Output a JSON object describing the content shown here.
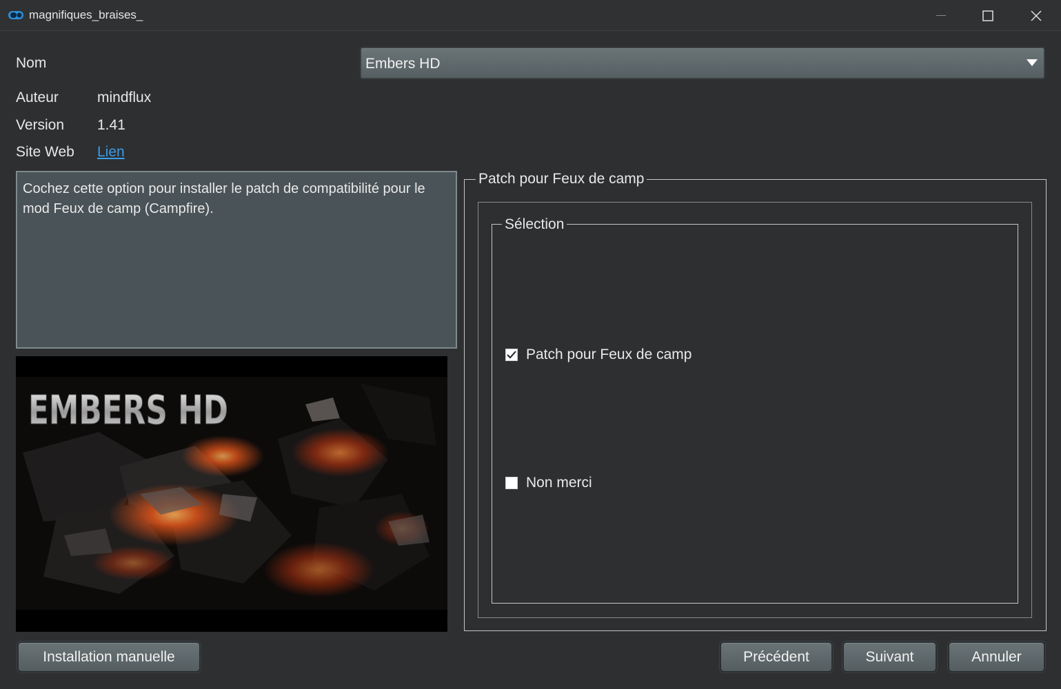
{
  "window": {
    "title": "magnifiques_braises_",
    "minimize": "—",
    "maximize": "☐",
    "close": "✕"
  },
  "fields": {
    "nom_label": "Nom",
    "nom_value": "Embers HD",
    "auteur_label": "Auteur",
    "auteur_value": "mindflux",
    "version_label": "Version",
    "version_value": "1.41",
    "site_label": "Site Web",
    "site_link": "Lien"
  },
  "description": "Cochez cette option pour installer le patch de compatibilité pour le mod Feux de camp (Campfire).",
  "preview": {
    "logo_text": "EMBERS HD"
  },
  "group": {
    "title": "Patch pour Feux de camp",
    "selection_title": "Sélection",
    "options": [
      {
        "label": "Patch pour Feux de camp",
        "checked": true
      },
      {
        "label": "Non merci",
        "checked": false
      }
    ]
  },
  "buttons": {
    "manual": "Installation manuelle",
    "previous": "Précédent",
    "next": "Suivant",
    "cancel": "Annuler"
  },
  "colors": {
    "background": "#2e2f31",
    "link": "#3a9de8",
    "button": "#5f686b",
    "desc_bg": "#4a5357"
  }
}
